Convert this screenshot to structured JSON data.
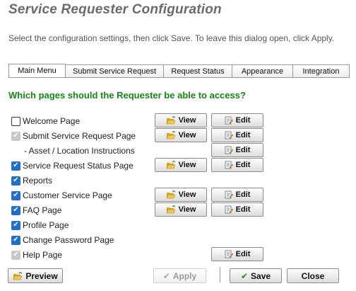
{
  "dialog": {
    "title": "Service Requester Configuration",
    "instructions": "Select the configuration settings, then click Save. To leave this dialog open, click Apply."
  },
  "tabs": [
    {
      "label": "Main Menu",
      "active": true
    },
    {
      "label": "Submit Service Request",
      "active": false
    },
    {
      "label": "Request Status",
      "active": false
    },
    {
      "label": "Appearance",
      "active": false
    },
    {
      "label": "Integration",
      "active": false
    }
  ],
  "question": "Which pages should the Requester be able to access?",
  "pages": [
    {
      "label": "Welcome Page",
      "checked": false,
      "disabled": false,
      "view": "View",
      "edit": "Edit"
    },
    {
      "label": "Submit Service Request Page",
      "checked": true,
      "disabled": true,
      "view": "View",
      "edit": "Edit"
    },
    {
      "label": "- Asset / Location Instructions",
      "edit": "Edit"
    },
    {
      "label": "Service Request Status Page",
      "checked": true,
      "disabled": false,
      "view": "View",
      "edit": "Edit"
    },
    {
      "label": "Reports",
      "checked": true,
      "disabled": false
    },
    {
      "label": "Customer Service Page",
      "checked": true,
      "disabled": false,
      "view": "View",
      "edit": "Edit"
    },
    {
      "label": "FAQ Page",
      "checked": true,
      "disabled": false,
      "view": "View",
      "edit": "Edit"
    },
    {
      "label": "Profile Page",
      "checked": true,
      "disabled": false
    },
    {
      "label": "Change Password Page",
      "checked": true,
      "disabled": false
    },
    {
      "label": "Help Page",
      "checked": true,
      "disabled": true,
      "edit": "Edit"
    }
  ],
  "footer": {
    "preview": "Preview",
    "apply": "Apply",
    "save": "Save",
    "close": "Close"
  },
  "icons": {
    "view": "folder-open-icon",
    "edit": "edit-document-icon",
    "check": "checkmark-icon",
    "check_glyph": "✔"
  },
  "colors": {
    "title": "#6b6b6b",
    "question": "#128a12",
    "checkbox": "#1f6fd1",
    "save_check": "#1e8f1e"
  }
}
